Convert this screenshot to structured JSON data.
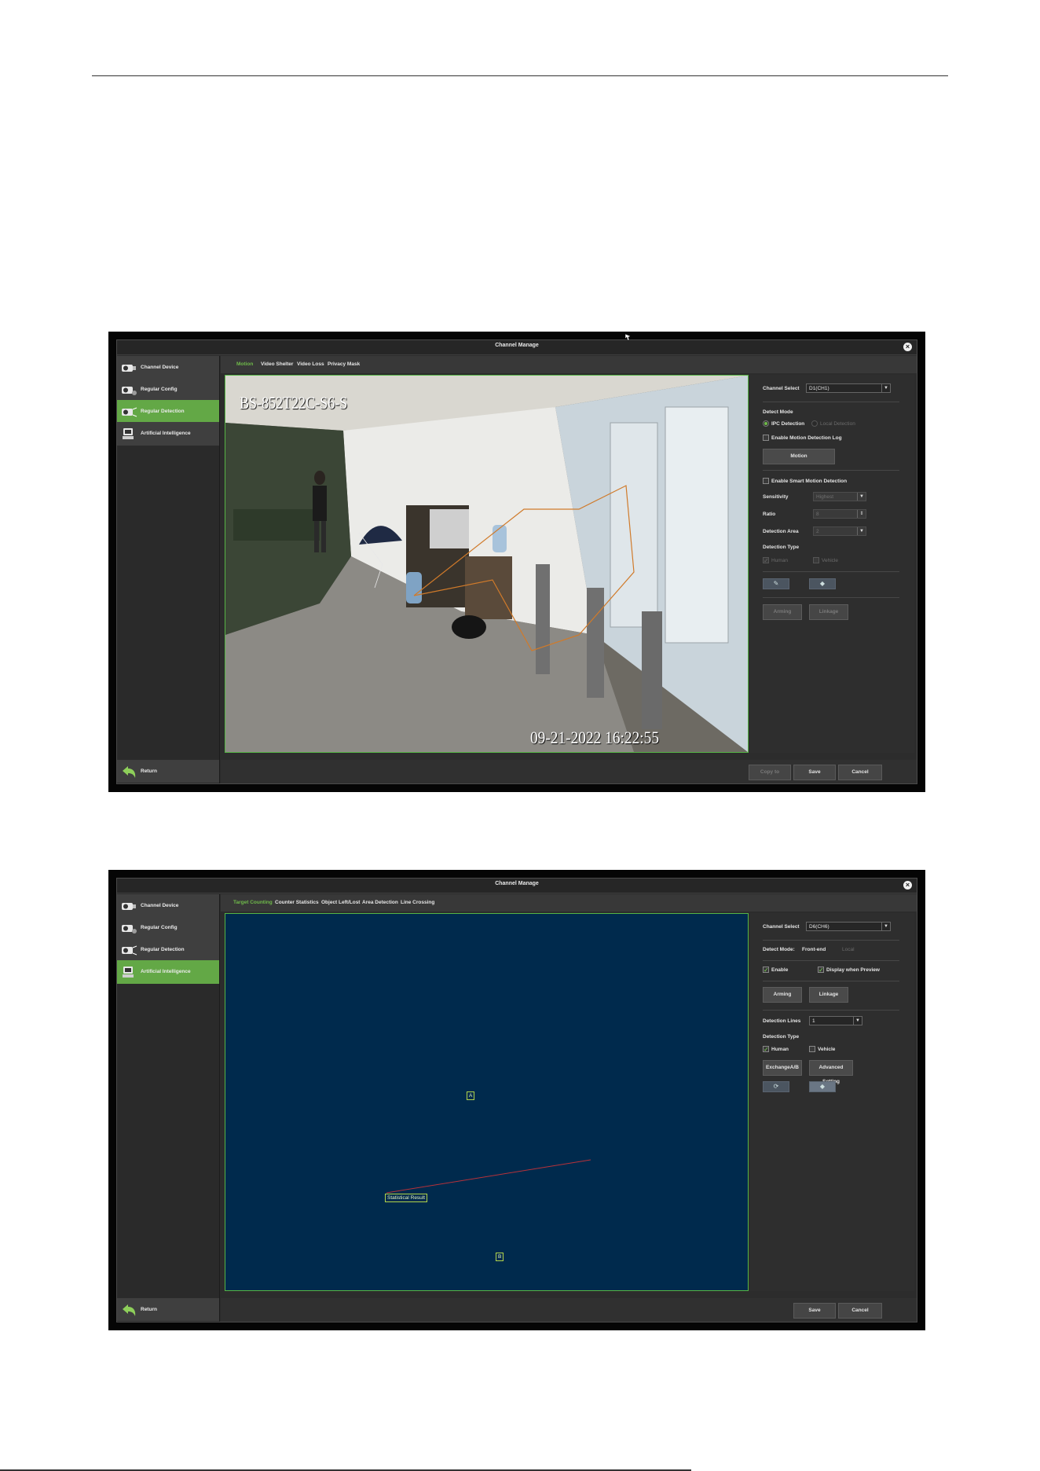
{
  "screen1": {
    "window_title": "Channel Manage",
    "sidebar": [
      {
        "label": "Channel Device",
        "active": false
      },
      {
        "label": "Regular Config",
        "active": false
      },
      {
        "label": "Regular Detection",
        "active": true
      },
      {
        "label": "Artificial Intelligence",
        "active": false
      }
    ],
    "return_label": "Return",
    "tabs": [
      {
        "label": "Motion",
        "active": true
      },
      {
        "label": "Video Shelter",
        "active": false
      },
      {
        "label": "Video Loss",
        "active": false
      },
      {
        "label": "Privacy Mask",
        "active": false
      }
    ],
    "osd_name": "BS-852T22C-S6-S",
    "osd_timestamp": "09-21-2022 16:22:55",
    "panel": {
      "channel_select_label": "Channel Select",
      "channel_value": "D1(CH1)",
      "detect_mode_label": "Detect Mode",
      "ipc_detection": "IPC Detection",
      "local_detection": "Local Detection",
      "enable_motion_log": "Enable Motion Detection Log",
      "motion_button": "Motion",
      "enable_smart_motion": "Enable Smart Motion Detection",
      "sensitivity_label": "Sensitivity",
      "sensitivity_value": "Highest",
      "ratio_label": "Ratio",
      "ratio_value": "8",
      "detection_area_label": "Detection Area",
      "detection_area_value": "2",
      "detection_type_label": "Detection Type",
      "human": "Human",
      "vehicle": "Vehicle",
      "arming": "Arming",
      "linkage": "Linkage"
    },
    "buttons": {
      "copy_to": "Copy to",
      "save": "Save",
      "cancel": "Cancel"
    }
  },
  "screen2": {
    "window_title": "Channel Manage",
    "sidebar": [
      {
        "label": "Channel Device",
        "active": false
      },
      {
        "label": "Regular Config",
        "active": false
      },
      {
        "label": "Regular Detection",
        "active": false
      },
      {
        "label": "Artificial Intelligence",
        "active": true
      }
    ],
    "return_label": "Return",
    "tabs": [
      {
        "label": "Target Counting",
        "active": true
      },
      {
        "label": "Counter Statistics",
        "active": false
      },
      {
        "label": "Object Left/Lost",
        "active": false
      },
      {
        "label": "Area Detection",
        "active": false
      },
      {
        "label": "Line Crossing",
        "active": false
      }
    ],
    "markers": {
      "a": "A",
      "b": "B",
      "result": "Statistical Result"
    },
    "panel": {
      "channel_select_label": "Channel Select",
      "channel_value": "D6(CH6)",
      "detect_mode_label": "Detect Mode:",
      "front_end": "Front-end",
      "local": "Local",
      "enable": "Enable",
      "display_when_preview": "Display when Preview",
      "arming": "Arming",
      "linkage": "Linkage",
      "detection_lines_label": "Detection Lines",
      "detection_lines_value": "1",
      "detection_type_label": "Detection Type",
      "human": "Human",
      "vehicle": "Vehicle",
      "exchange_ab": "ExchangeA/B",
      "advanced_setting": "Advanced Setting"
    },
    "buttons": {
      "save": "Save",
      "cancel": "Cancel"
    }
  },
  "colors": {
    "accent_green": "#63a846",
    "frame_green": "#56b545",
    "canvas_blue": "#002a4d"
  },
  "icons": [
    "camera-icon",
    "settings-camera-icon",
    "detection-camera-icon",
    "ai-robot-icon",
    "return-arrow-icon",
    "close-icon",
    "pencil-icon",
    "eraser-icon",
    "refresh-icon"
  ]
}
